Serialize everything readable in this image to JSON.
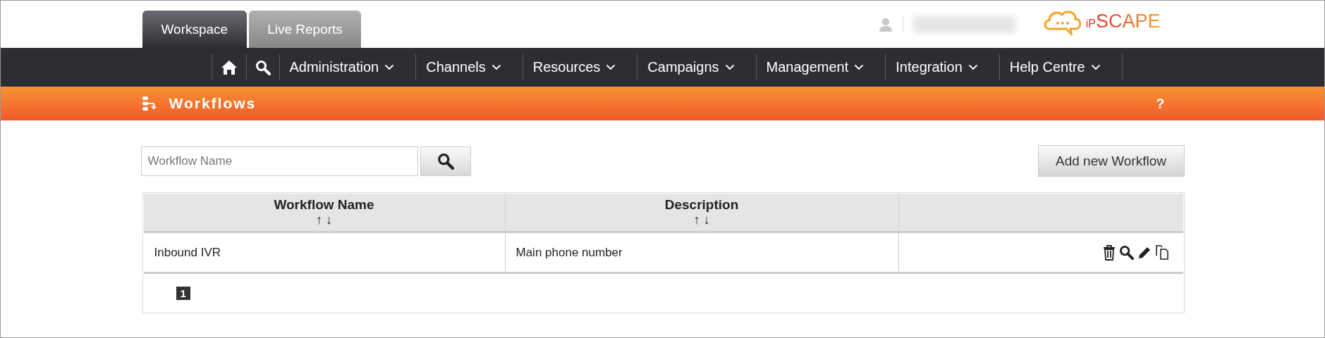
{
  "tabs": [
    {
      "label": "Workspace",
      "selected": true
    },
    {
      "label": "Live Reports",
      "selected": false
    }
  ],
  "logo": {
    "prefix": "iP",
    "name": "SCAPE"
  },
  "nav": {
    "items": [
      {
        "label": "Administration"
      },
      {
        "label": "Channels"
      },
      {
        "label": "Resources"
      },
      {
        "label": "Campaigns"
      },
      {
        "label": "Management"
      },
      {
        "label": "Integration"
      },
      {
        "label": "Help Centre"
      }
    ]
  },
  "page_header": {
    "title": "Workflows",
    "help": "?"
  },
  "search": {
    "placeholder": "Workflow Name"
  },
  "add_button": "Add new Workflow",
  "table": {
    "columns": [
      {
        "label": "Workflow Name",
        "sort": "↑ ↓"
      },
      {
        "label": "Description",
        "sort": "↑ ↓"
      },
      {}
    ],
    "rows": [
      {
        "cells": [
          "Inbound IVR",
          "Main phone number"
        ]
      }
    ],
    "pages": [
      {
        "label": "1",
        "selected": true
      }
    ]
  }
}
